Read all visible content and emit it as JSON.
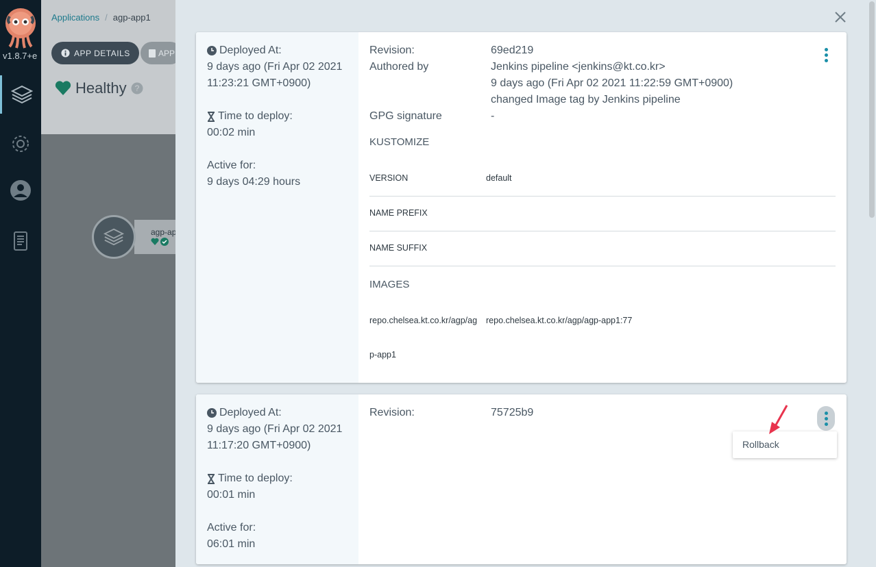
{
  "nav": {
    "version": "v1.8.7+e",
    "items": [
      "applications-icon",
      "settings-icon",
      "user-icon",
      "docs-icon"
    ]
  },
  "background": {
    "breadcrumb": {
      "root": "Applications",
      "current": "agp-app1"
    },
    "app_details_label": "APP DETAILS",
    "app_diff_label": "APP",
    "health": "Healthy",
    "node_label": "agp-ap"
  },
  "history": [
    {
      "deployed_at_label": "Deployed At:",
      "deployed_at_line1": "9 days ago (Fri Apr 02 2021",
      "deployed_at_line2": "11:23:21 GMT+0900)",
      "time_to_deploy_label": "Time to deploy:",
      "time_to_deploy": "00:02 min",
      "active_for_label": "Active for:",
      "active_for": "9 days 04:29 hours",
      "revision_label": "Revision:",
      "revision": "69ed219",
      "authored_by_label": "Authored by",
      "author": "Jenkins pipeline <jenkins@kt.co.kr>",
      "authored_when": "9 days ago (Fri Apr 02 2021 11:22:59 GMT+0900)",
      "message": "changed Image tag by Jenkins pipeline",
      "gpg_label": "GPG signature",
      "gpg_value": "-",
      "kustomize_label": "KUSTOMIZE",
      "version_label": "VERSION",
      "version_value": "default",
      "name_prefix_label": "NAME PREFIX",
      "name_suffix_label": "NAME SUFFIX",
      "images_label": "IMAGES",
      "image_key_line1": "repo.chelsea.kt.co.kr/agp/ag",
      "image_key_line2": "p-app1",
      "image_value": "repo.chelsea.kt.co.kr/agp/agp-app1:77"
    },
    {
      "deployed_at_label": "Deployed At:",
      "deployed_at_line1": "9 days ago (Fri Apr 02 2021",
      "deployed_at_line2": "11:17:20 GMT+0900)",
      "time_to_deploy_label": "Time to deploy:",
      "time_to_deploy": "00:01 min",
      "active_for_label": "Active for:",
      "active_for": "06:01 min",
      "revision_label": "Revision:",
      "revision": "75725b9"
    }
  ],
  "menu": {
    "rollback": "Rollback"
  },
  "colors": {
    "accent": "#1a8fa8",
    "healthy": "#18be94",
    "arrow": "#e8344e"
  }
}
